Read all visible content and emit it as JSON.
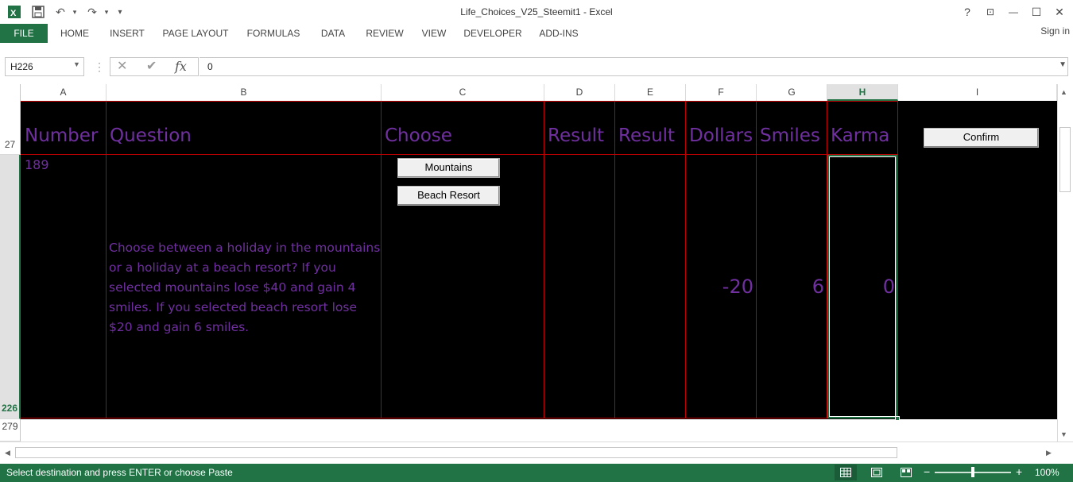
{
  "window": {
    "title": "Life_Choices_V25_Steemit1 - Excel",
    "help": "?",
    "restore_ribbon": "⊡",
    "minimize": "—",
    "maximize": "☐",
    "close": "✕"
  },
  "quick_access": {
    "app_icon": "excel-icon",
    "save": "💾",
    "undo": "↶",
    "redo": "↷",
    "customize": "▾"
  },
  "ribbon": {
    "tabs": [
      "FILE",
      "HOME",
      "INSERT",
      "PAGE LAYOUT",
      "FORMULAS",
      "DATA",
      "REVIEW",
      "VIEW",
      "DEVELOPER",
      "ADD-INS"
    ],
    "sign_in": "Sign in"
  },
  "formula_bar": {
    "name_box": "H226",
    "cancel": "✕",
    "enter": "✔",
    "fx": "fx",
    "value": "0"
  },
  "columns": [
    "A",
    "B",
    "C",
    "D",
    "E",
    "F",
    "G",
    "H",
    "I"
  ],
  "selected_column": "H",
  "rows": {
    "r27": "27",
    "r226": "226",
    "r279": "279"
  },
  "sheet": {
    "headers": {
      "number": "Number",
      "question": "Question",
      "choose": "Choose",
      "result1": "Result",
      "result2": "Result",
      "dollars": "Dollars",
      "smiles": "Smiles",
      "karma": "Karma"
    },
    "row": {
      "number": "189",
      "question": "Choose between a holiday in the mountains or a holiday at a beach resort? If you selected mountains lose $40 and gain 4 smiles. If you selected beach resort lose $20 and gain 6 smiles.",
      "dollars": "-20",
      "smiles": "6",
      "karma": "0"
    },
    "buttons": {
      "mountains": "Mountains",
      "beach_resort": "Beach Resort",
      "confirm": "Confirm"
    }
  },
  "status_bar": {
    "message": "Select destination and press ENTER or choose Paste",
    "zoom": "100%",
    "zoom_minus": "−",
    "zoom_plus": "+"
  },
  "colors": {
    "excel_green": "#217346",
    "text_purple": "#7030a0",
    "border_red": "#c00000",
    "sheet_background": "#000000"
  }
}
